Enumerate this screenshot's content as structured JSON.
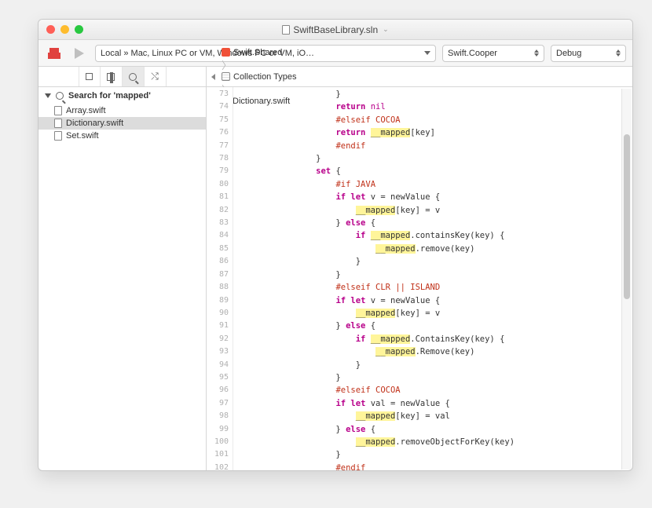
{
  "title": "SwiftBaseLibrary.sln",
  "toolbar": {
    "path": "Local » Mac, Linux PC or VM, Windows PC or VM, iO…",
    "scheme": "Swift.Cooper",
    "config": "Debug"
  },
  "search_header": "Search for 'mapped'",
  "files": [
    {
      "name": "Array.swift",
      "selected": false
    },
    {
      "name": "Dictionary.swift",
      "selected": true
    },
    {
      "name": "Set.swift",
      "selected": false
    }
  ],
  "crumbs": [
    {
      "icon": "swift",
      "label": "Swift.Shared"
    },
    {
      "icon": "group",
      "label": "Collection Types"
    },
    {
      "icon": "file",
      "label": "Dictionary.swift"
    }
  ],
  "first_line": 73,
  "code": [
    {
      "i": 5,
      "seg": [
        [
          "",
          "}"
        ]
      ]
    },
    {
      "i": 5,
      "seg": [
        [
          "kw",
          "return"
        ],
        [
          "",
          " "
        ],
        [
          "lit",
          "nil"
        ]
      ]
    },
    {
      "i": 5,
      "seg": [
        [
          "pp",
          "#elseif COCOA"
        ]
      ]
    },
    {
      "i": 5,
      "seg": [
        [
          "kw",
          "return"
        ],
        [
          "",
          " "
        ],
        [
          "hl",
          "__mapped"
        ],
        [
          "",
          "[key]"
        ]
      ]
    },
    {
      "i": 5,
      "seg": [
        [
          "pp",
          "#endif"
        ]
      ]
    },
    {
      "i": 4,
      "seg": [
        [
          "",
          "}"
        ]
      ]
    },
    {
      "i": 4,
      "seg": [
        [
          "kw",
          "set"
        ],
        [
          "",
          " {"
        ]
      ]
    },
    {
      "i": 5,
      "seg": [
        [
          "pp",
          "#if JAVA"
        ]
      ]
    },
    {
      "i": 5,
      "seg": [
        [
          "kw",
          "if"
        ],
        [
          "",
          " "
        ],
        [
          "kw",
          "let"
        ],
        [
          "",
          " v = newValue {"
        ]
      ]
    },
    {
      "i": 6,
      "seg": [
        [
          "hl",
          "__mapped"
        ],
        [
          "",
          "[key] = v"
        ]
      ]
    },
    {
      "i": 5,
      "seg": [
        [
          "",
          "} "
        ],
        [
          "kw",
          "else"
        ],
        [
          "",
          " {"
        ]
      ]
    },
    {
      "i": 6,
      "seg": [
        [
          "kw",
          "if"
        ],
        [
          "",
          " "
        ],
        [
          "hl",
          "__mapped"
        ],
        [
          "",
          ".containsKey(key) {"
        ]
      ]
    },
    {
      "i": 7,
      "seg": [
        [
          "hl",
          "__mapped"
        ],
        [
          "",
          ".remove(key)"
        ]
      ]
    },
    {
      "i": 6,
      "seg": [
        [
          "",
          "}"
        ]
      ]
    },
    {
      "i": 5,
      "seg": [
        [
          "",
          "}"
        ]
      ]
    },
    {
      "i": 5,
      "seg": [
        [
          "pp",
          "#elseif CLR || ISLAND"
        ]
      ]
    },
    {
      "i": 5,
      "seg": [
        [
          "kw",
          "if"
        ],
        [
          "",
          " "
        ],
        [
          "kw",
          "let"
        ],
        [
          "",
          " v = newValue {"
        ]
      ]
    },
    {
      "i": 6,
      "seg": [
        [
          "hl",
          "__mapped"
        ],
        [
          "",
          "[key] = v"
        ]
      ]
    },
    {
      "i": 5,
      "seg": [
        [
          "",
          "} "
        ],
        [
          "kw",
          "else"
        ],
        [
          "",
          " {"
        ]
      ]
    },
    {
      "i": 6,
      "seg": [
        [
          "kw",
          "if"
        ],
        [
          "",
          " "
        ],
        [
          "hl",
          "__mapped"
        ],
        [
          "",
          ".ContainsKey(key) {"
        ]
      ]
    },
    {
      "i": 7,
      "seg": [
        [
          "hl",
          "__mapped"
        ],
        [
          "",
          ".Remove(key)"
        ]
      ]
    },
    {
      "i": 6,
      "seg": [
        [
          "",
          "}"
        ]
      ]
    },
    {
      "i": 5,
      "seg": [
        [
          "",
          "}"
        ]
      ]
    },
    {
      "i": 5,
      "seg": [
        [
          "pp",
          "#elseif COCOA"
        ]
      ]
    },
    {
      "i": 5,
      "seg": [
        [
          "kw",
          "if"
        ],
        [
          "",
          " "
        ],
        [
          "kw",
          "let"
        ],
        [
          "",
          " val = newValue {"
        ]
      ]
    },
    {
      "i": 6,
      "seg": [
        [
          "hl",
          "__mapped"
        ],
        [
          "",
          "[key] = val"
        ]
      ]
    },
    {
      "i": 5,
      "seg": [
        [
          "",
          "} "
        ],
        [
          "kw",
          "else"
        ],
        [
          "",
          " {"
        ]
      ]
    },
    {
      "i": 6,
      "seg": [
        [
          "hl",
          "__mapped"
        ],
        [
          "",
          ".removeObjectForKey(key)"
        ]
      ]
    },
    {
      "i": 5,
      "seg": [
        [
          "",
          "}"
        ]
      ]
    },
    {
      "i": 5,
      "seg": [
        [
          "pp",
          "#endif"
        ]
      ]
    },
    {
      "i": 4,
      "seg": [
        [
          "",
          "}"
        ]
      ]
    },
    {
      "i": 3,
      "seg": [
        [
          "",
          "}"
        ]
      ]
    },
    {
      "i": 0,
      "seg": [
        [
          "",
          ""
        ]
      ]
    }
  ]
}
